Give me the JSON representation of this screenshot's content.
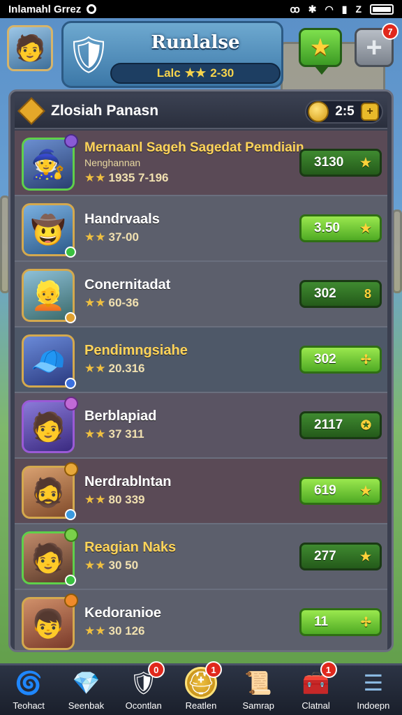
{
  "status_bar": {
    "carrier": "Inlamahl Grrez",
    "icons": [
      "circle-icon",
      "nfc-icon",
      "bluetooth-icon",
      "wifi-icon",
      "signal-icon",
      "sim-icon",
      "battery-icon"
    ]
  },
  "header": {
    "game_title": "Runlalse",
    "level_label": "Lalc",
    "level_value": "2-30",
    "star_button_icon": "star-icon",
    "plus_button_icon": "plus-icon",
    "plus_badge": "7"
  },
  "panel": {
    "title": "Zlosiah Panasn",
    "coins": "2:5"
  },
  "rows": [
    {
      "name": "Mernaanl Sageh Sagedat Pemdiain",
      "sub": "Nenghannan",
      "stars": "★★",
      "rating": "1935 7-196",
      "button_value": "3130",
      "button_icon": "★"
    },
    {
      "name": "Handrvaals",
      "sub": "",
      "stars": "★★",
      "rating": "37-00",
      "button_value": "3.50",
      "button_icon": "★"
    },
    {
      "name": "Conernitadat",
      "sub": "",
      "stars": "★★",
      "rating": "60-36",
      "button_value": "302",
      "button_icon": "8"
    },
    {
      "name": "Pendimngsiahe",
      "sub": "",
      "stars": "★★",
      "rating": "20.316",
      "button_value": "302",
      "button_icon": "✢"
    },
    {
      "name": "Berblapiad",
      "sub": "",
      "stars": "★★",
      "rating": "37 311",
      "button_value": "2117",
      "button_icon": "✪"
    },
    {
      "name": "Nerdrablntan",
      "sub": "",
      "stars": "★★",
      "rating": "80 339",
      "button_value": "619",
      "button_icon": "★"
    },
    {
      "name": "Reagian Naks",
      "sub": "",
      "stars": "★★",
      "rating": "30 50",
      "button_value": "277",
      "button_icon": "★"
    },
    {
      "name": "Kedoranioe",
      "sub": "",
      "stars": "★★",
      "rating": "30 126",
      "button_value": "11",
      "button_icon": "✢"
    }
  ],
  "bottom_nav": [
    {
      "label": "Teohact",
      "icon": "swirl-icon",
      "badge": ""
    },
    {
      "label": "Seenbak",
      "icon": "gem-icon",
      "badge": ""
    },
    {
      "label": "Ocontlan",
      "icon": "shield-icon",
      "badge": "0"
    },
    {
      "label": "Reatlen",
      "icon": "helmet-icon",
      "badge": "1"
    },
    {
      "label": "Samrap",
      "icon": "scroll-icon",
      "badge": ""
    },
    {
      "label": "Clatnal",
      "icon": "chest-icon",
      "badge": "1"
    },
    {
      "label": "Indoepn",
      "icon": "list-icon",
      "badge": ""
    }
  ]
}
